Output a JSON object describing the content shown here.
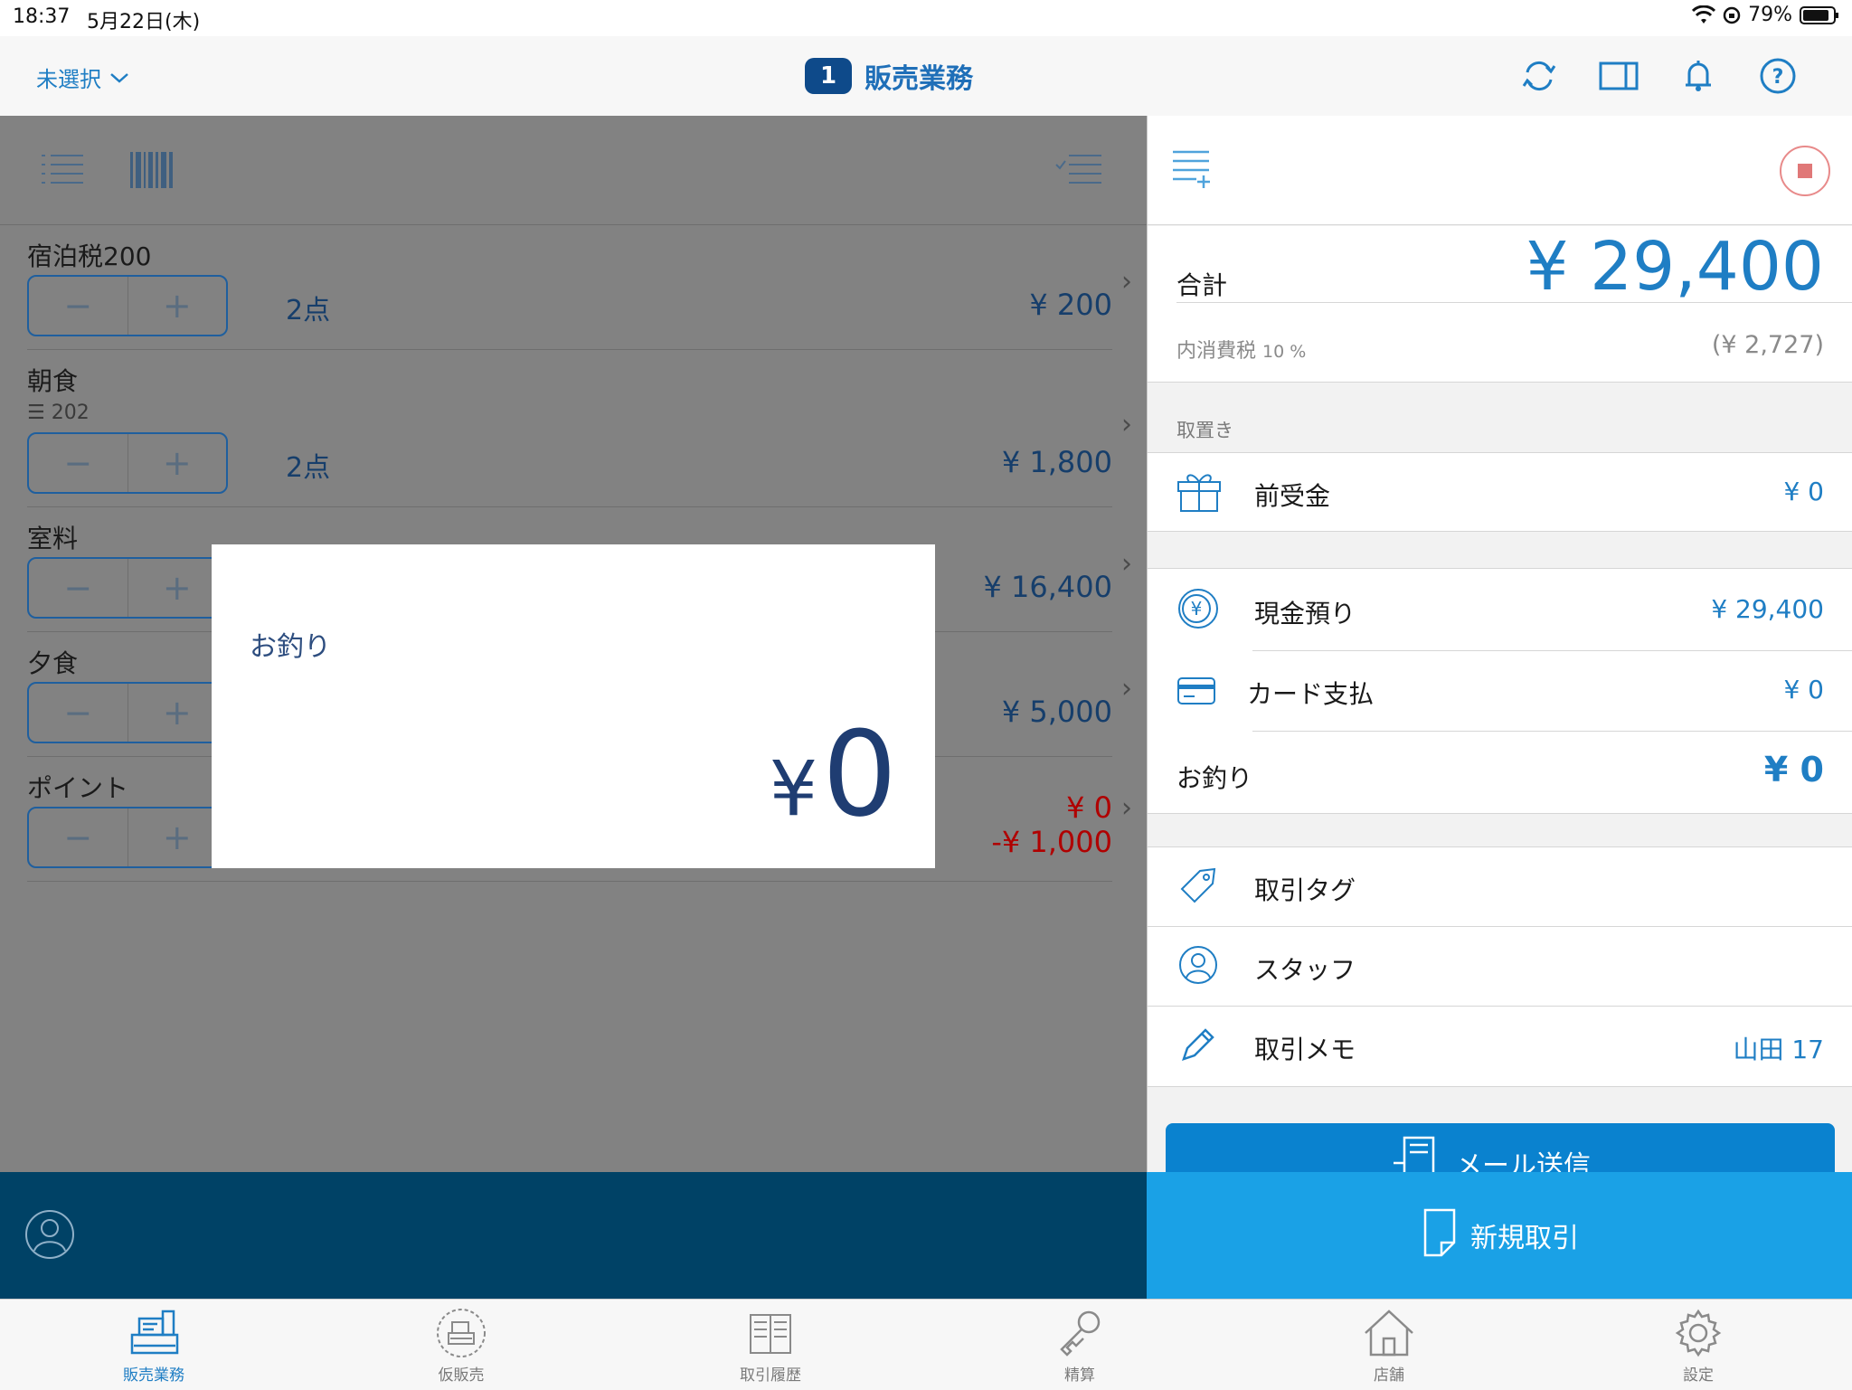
{
  "status_bar": {
    "time": "18:37",
    "date": "5月22日(木)",
    "battery": "79%"
  },
  "nav": {
    "selector_label": "未選択",
    "badge": "1",
    "title": "販売業務"
  },
  "items": [
    {
      "name": "宿泊税200",
      "sub": "",
      "qty": "2点",
      "price": "¥ 200",
      "price2": ""
    },
    {
      "name": "朝食",
      "sub": "☰ 202",
      "qty": "2点",
      "price": "¥ 1,800",
      "price2": ""
    },
    {
      "name": "室料",
      "sub": "",
      "qty": "",
      "price": "¥ 16,400",
      "price2": ""
    },
    {
      "name": "夕食",
      "sub": "",
      "qty": "",
      "price": "¥ 5,000",
      "price2": ""
    },
    {
      "name": "ポイント",
      "sub": "",
      "qty": "",
      "price": "¥ 0",
      "price2": "-¥ 1,000"
    }
  ],
  "stepper": {
    "minus": "−",
    "plus": "+"
  },
  "modal": {
    "label": "お釣り",
    "yen": "¥",
    "amount": "0"
  },
  "summary": {
    "total_label": "合計",
    "total_value": "¥ 29,400",
    "tax_label": "内消費税",
    "tax_rate": "10 %",
    "tax_value": "(¥ 2,727)",
    "hold_label": "取置き",
    "advance_label": "前受金",
    "advance_value": "¥ 0",
    "cash_label": "現金預り",
    "cash_value": "¥ 29,400",
    "card_label": "カード支払",
    "card_value": "¥ 0",
    "change_label": "お釣り",
    "change_value": "¥ 0",
    "tag_label": "取引タグ",
    "staff_label": "スタッフ",
    "memo_label": "取引メモ",
    "memo_value": "山田 17",
    "mail_label": "メール送信",
    "new_label": "新規取引"
  },
  "tabs": [
    {
      "label": "販売業務",
      "icon": "register-icon",
      "active": true
    },
    {
      "label": "仮販売",
      "icon": "temp-register-icon",
      "active": false
    },
    {
      "label": "取引履歴",
      "icon": "book-icon",
      "active": false
    },
    {
      "label": "精算",
      "icon": "key-icon",
      "active": false
    },
    {
      "label": "店舗",
      "icon": "house-icon",
      "active": false
    },
    {
      "label": "設定",
      "icon": "gear-icon",
      "active": false
    }
  ],
  "colors": {
    "accent": "#1f7ec4",
    "dark_bar": "#004266",
    "bright_bar": "#1aa1e6",
    "negative": "#b00000"
  }
}
